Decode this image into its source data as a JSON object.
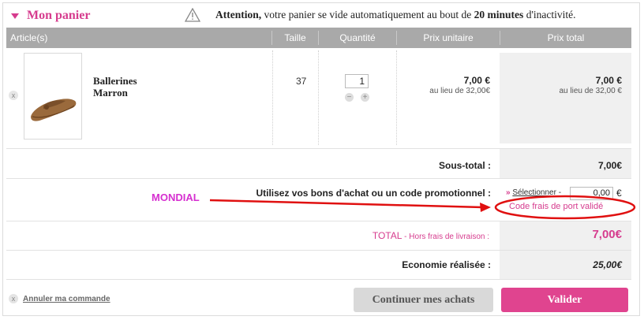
{
  "header": {
    "title": "Mon panier",
    "warning_prefix": "Attention,",
    "warning_mid": " votre panier se vide automatiquement au bout de ",
    "warning_bold": "20 minutes",
    "warning_suffix": " d'inactivité."
  },
  "table": {
    "columns": [
      "Article(s)",
      "Taille",
      "Quantité",
      "Prix unitaire",
      "Prix total"
    ]
  },
  "item": {
    "remove_label": "x",
    "name_line1": "Ballerines",
    "name_line2": "Marron",
    "size": "37",
    "quantity": "1",
    "unit_price": "7,00 €",
    "unit_was": "au lieu de 32,00€",
    "total_price": "7,00 €",
    "total_was": "au lieu de 32,00 €"
  },
  "summary": {
    "subtotal_label": "Sous-total :",
    "subtotal_value": "7,00€",
    "voucher_label": "Utilisez vos bons d'achat ou un code promotionnel :",
    "select_prefix": "»",
    "select_label": "Sélectionner -",
    "voucher_value": "0,00",
    "currency": "€",
    "code_message": "Code frais de port validé",
    "annotation": "MONDIAL",
    "total_label": "TOTAL",
    "total_sub": " - Hors frais de livraison :",
    "total_value": "7,00€",
    "savings_label": "Economie réalisée :",
    "savings_value": "25,00€"
  },
  "actions": {
    "cancel_icon": "x",
    "cancel_label": "Annuler ma commande",
    "continue_label": "Continuer mes achats",
    "validate_label": "Valider"
  },
  "colors": {
    "accent": "#d63c8e",
    "header_bar": "#a9a9a9",
    "annotation": "#d62fd0",
    "markup_red": "#e01010"
  }
}
